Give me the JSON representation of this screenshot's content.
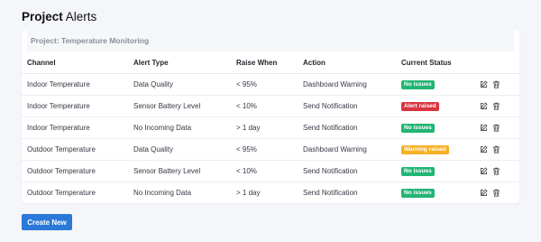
{
  "page": {
    "title_bold": "Project",
    "title_rest": "Alerts"
  },
  "card": {
    "project_label": "Project: Temperature Monitoring"
  },
  "table": {
    "headers": [
      "Channel",
      "Alert Type",
      "Raise When",
      "Action",
      "Current Status"
    ],
    "rows": [
      {
        "channel": "Indoor Temperature",
        "alert_type": "Data Quality",
        "raise_when": "< 95%",
        "action": "Dashboard Warning",
        "status": "No issues",
        "status_color": "#22b573"
      },
      {
        "channel": "Indoor Temperature",
        "alert_type": "Sensor Battery Level",
        "raise_when": "< 10%",
        "action": "Send Notification",
        "status": "Alert raised",
        "status_color": "#d9343f"
      },
      {
        "channel": "Indoor Temperature",
        "alert_type": "No Incoming Data",
        "raise_when": "> 1 day",
        "action": "Send Notification",
        "status": "No issues",
        "status_color": "#22b573"
      },
      {
        "channel": "Outdoor Temperature",
        "alert_type": "Data Quality",
        "raise_when": "< 95%",
        "action": "Dashboard Warning",
        "status": "Warning raised",
        "status_color": "#f5b025"
      },
      {
        "channel": "Outdoor Temperature",
        "alert_type": "Sensor Battery Level",
        "raise_when": "< 10%",
        "action": "Send Notification",
        "status": "No issues",
        "status_color": "#22b573"
      },
      {
        "channel": "Outdoor Temperature",
        "alert_type": "No Incoming Data",
        "raise_when": "> 1 day",
        "action": "Send Notification",
        "status": "No issues",
        "status_color": "#22b573"
      }
    ],
    "row_icons": [
      "edit-icon",
      "trash-icon"
    ]
  },
  "actions": {
    "create_label": "Create New"
  },
  "colors": {
    "accent": "#2a78d8",
    "ok": "#22b573",
    "alert": "#d9343f",
    "warning": "#f5b025"
  }
}
